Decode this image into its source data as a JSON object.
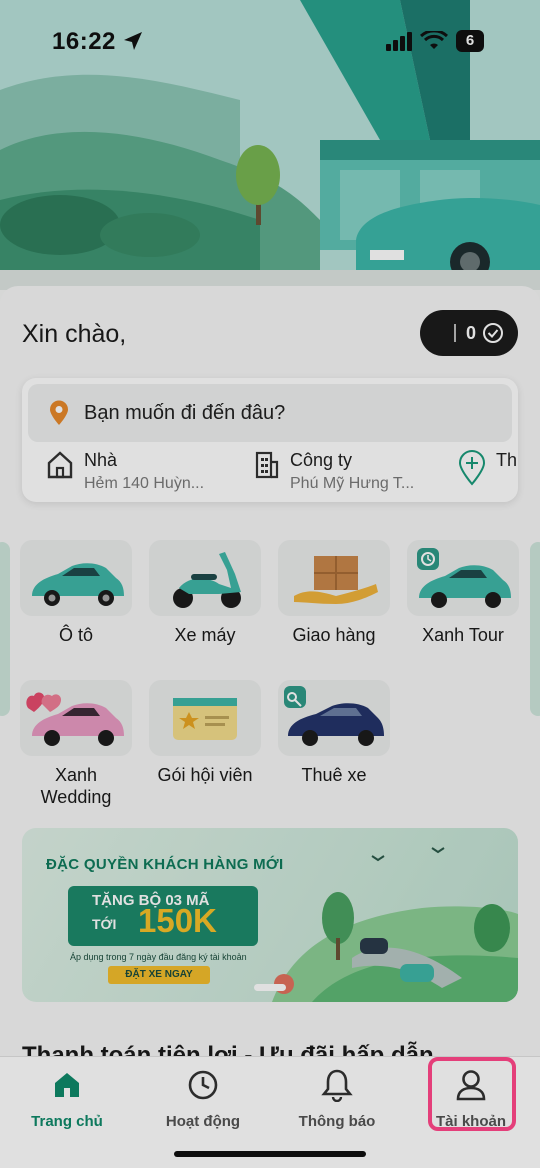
{
  "status_bar": {
    "time": "16:22",
    "battery": "6"
  },
  "greeting": "Xin chào,",
  "points": {
    "value": "0"
  },
  "destination": {
    "placeholder": "Bạn muốn đi đến đâu?",
    "shortcuts": [
      {
        "label": "Nhà",
        "sub": "Hẻm 140 Huỳn..."
      },
      {
        "label": "Công ty",
        "sub": "Phú Mỹ Hưng T..."
      },
      {
        "label": "Th"
      }
    ]
  },
  "services": [
    {
      "label": "Ô tô"
    },
    {
      "label": "Xe máy"
    },
    {
      "label": "Giao hàng"
    },
    {
      "label": "Xanh Tour"
    },
    {
      "label": "Xanh\nWedding"
    },
    {
      "label": "Gói hội viên"
    },
    {
      "label": "Thuê xe"
    }
  ],
  "banner": {
    "title": "ĐẶC QUYỀN KHÁCH HÀNG MỚI",
    "line1": "TẶNG BỘ 03 MÃ",
    "line2": "TỚI",
    "amount": "150K",
    "note": "Áp dụng trong 7 ngày đầu đăng ký tài khoản",
    "cta": "ĐẶT XE NGAY"
  },
  "section_title": "Thanh toán tiện lợi - Ưu đãi hấp dẫn",
  "tabs": [
    {
      "label": "Trang chủ",
      "active": true
    },
    {
      "label": "Hoạt động"
    },
    {
      "label": "Thông báo"
    },
    {
      "label": "Tài khoản"
    }
  ],
  "colors": {
    "accent": "#0f8a6a",
    "highlight": "#e43f7a"
  }
}
